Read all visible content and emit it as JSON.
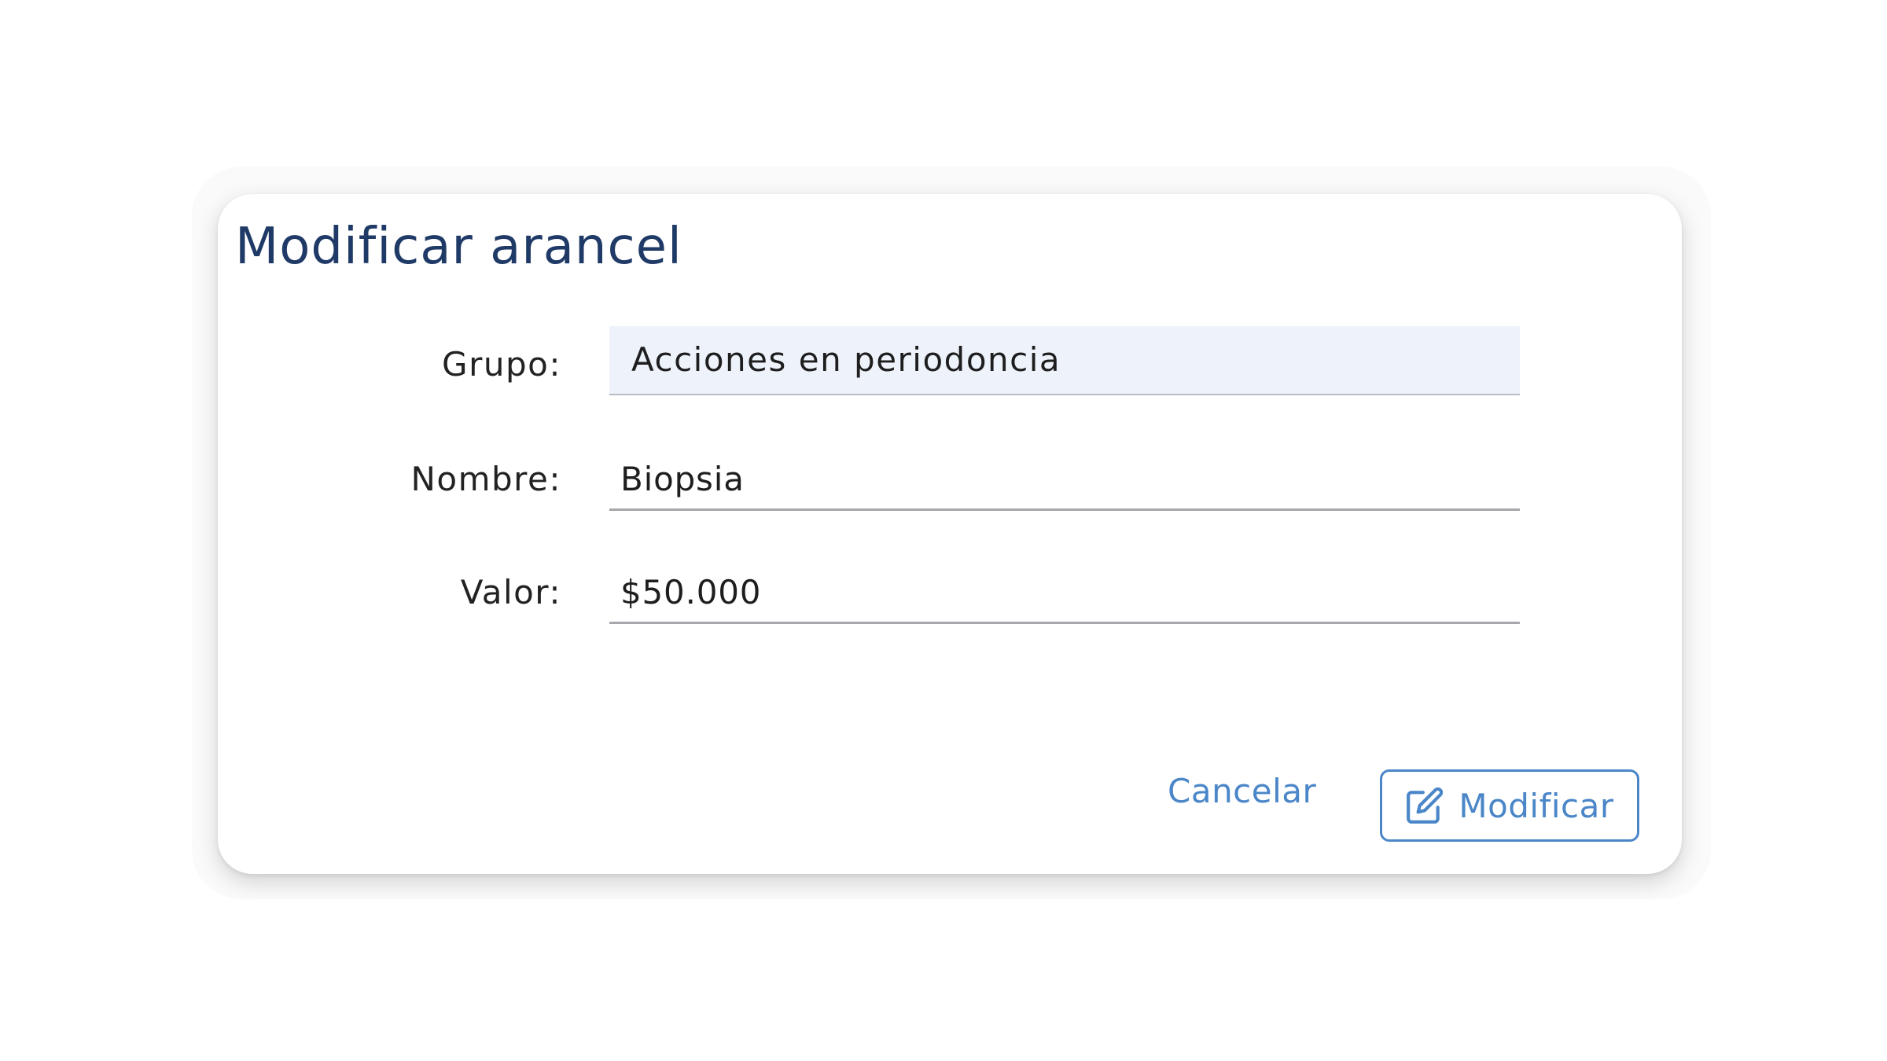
{
  "dialog": {
    "title": "Modificar arancel"
  },
  "form": {
    "grupo": {
      "label": "Grupo:",
      "value": "Acciones en periodoncia"
    },
    "nombre": {
      "label": "Nombre:",
      "value": "Biopsia"
    },
    "valor": {
      "label": "Valor:",
      "value": "$50.000"
    }
  },
  "actions": {
    "cancel_label": "Cancelar",
    "modify_label": "Modificar",
    "modify_icon": "edit-icon"
  },
  "colors": {
    "title": "#1f3a66",
    "accent": "#4a86c8",
    "filled_input_bg": "#eef2fa"
  }
}
